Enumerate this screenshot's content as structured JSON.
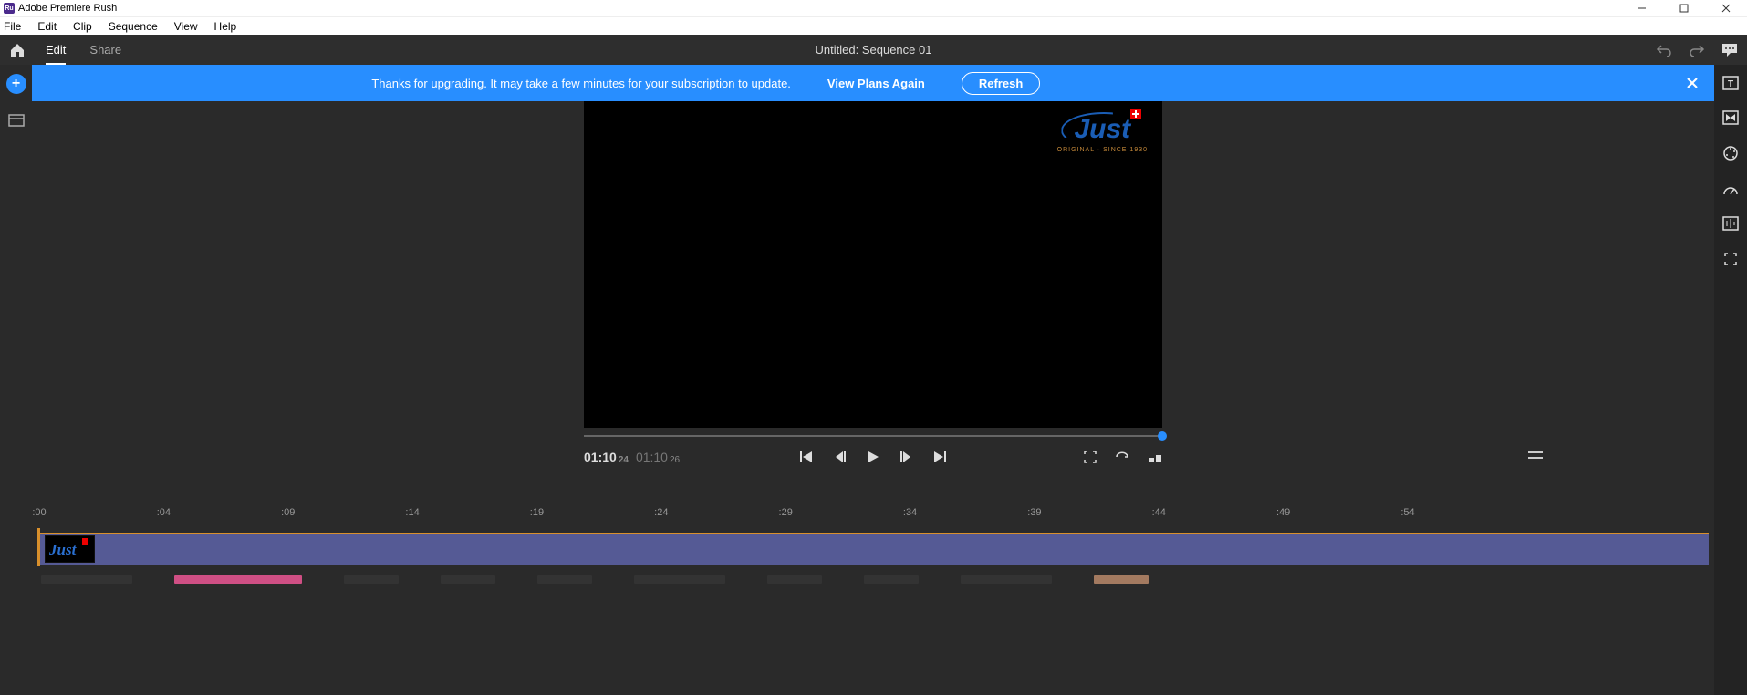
{
  "window": {
    "app_name": "Adobe Premiere Rush",
    "app_icon_text": "Ru"
  },
  "menu": {
    "file": "File",
    "edit": "Edit",
    "clip": "Clip",
    "sequence": "Sequence",
    "view": "View",
    "help": "Help"
  },
  "appbar": {
    "tab_edit": "Edit",
    "tab_share": "Share",
    "title": "Untitled: Sequence 01"
  },
  "banner": {
    "message": "Thanks for upgrading. It may take a few minutes for your subscription to update.",
    "view_plans": "View Plans Again",
    "refresh": "Refresh"
  },
  "preview": {
    "logo_text": "Just",
    "logo_subtitle": "ORIGINAL · SINCE 1930",
    "current_time": "01:10",
    "current_frames": "24",
    "duration_time": "01:10",
    "duration_frames": "26"
  },
  "ruler": {
    "marks": [
      ":00",
      ":04",
      ":09",
      ":14",
      ":19",
      ":24",
      ":29",
      ":34",
      ":39",
      ":44",
      ":49",
      ":54"
    ]
  }
}
